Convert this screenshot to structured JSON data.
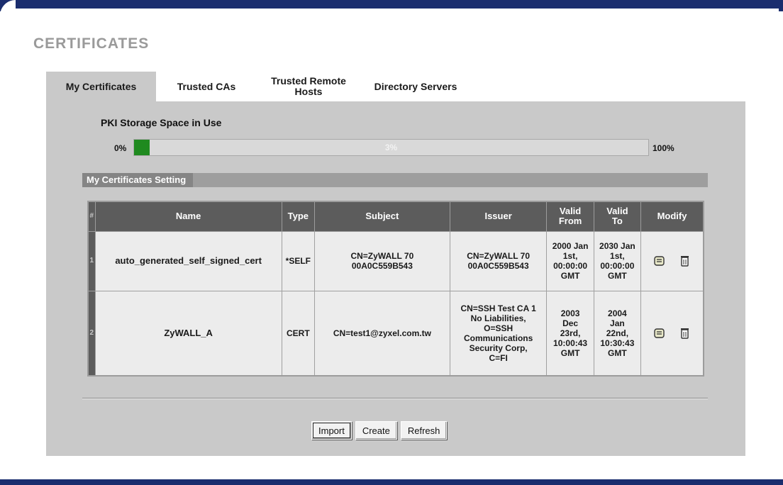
{
  "page": {
    "title": "CERTIFICATES"
  },
  "tabs": [
    {
      "label": "My Certificates",
      "active": true
    },
    {
      "label": "Trusted CAs",
      "active": false
    },
    {
      "label": "Trusted Remote Hosts",
      "active": false
    },
    {
      "label": "Directory Servers",
      "active": false
    }
  ],
  "storage": {
    "label": "PKI Storage Space in Use",
    "min_label": "0%",
    "max_label": "100%",
    "value_text": "3%",
    "value": 0.03,
    "fill_color": "#1f8a1f"
  },
  "settings": {
    "heading": "My Certificates Setting",
    "columns": {
      "num": "#",
      "name": "Name",
      "type": "Type",
      "subject": "Subject",
      "issuer": "Issuer",
      "valid_from": "Valid From",
      "valid_to": "Valid To",
      "modify": "Modify"
    },
    "rows": [
      {
        "num": "1",
        "name": "auto_generated_self_signed_cert",
        "type": "*SELF",
        "subject": "CN=ZyWALL 70 00A0C559B543",
        "issuer": "CN=ZyWALL 70 00A0C559B543",
        "valid_from": "2000 Jan 1st, 00:00:00 GMT",
        "valid_to": "2030 Jan 1st, 00:00:00 GMT"
      },
      {
        "num": "2",
        "name": "ZyWALL_A",
        "type": "CERT",
        "subject": "CN=test1@zyxel.com.tw",
        "issuer": "CN=SSH Test CA 1 No Liabilities, O=SSH Communications Security Corp, C=FI",
        "valid_from": "2003 Dec 23rd, 10:00:43 GMT",
        "valid_to": "2004 Jan 22nd, 10:30:43 GMT"
      }
    ],
    "icons": {
      "edit": "edit-icon",
      "delete": "trash-icon"
    }
  },
  "buttons": {
    "import": "Import",
    "create": "Create",
    "refresh": "Refresh"
  }
}
